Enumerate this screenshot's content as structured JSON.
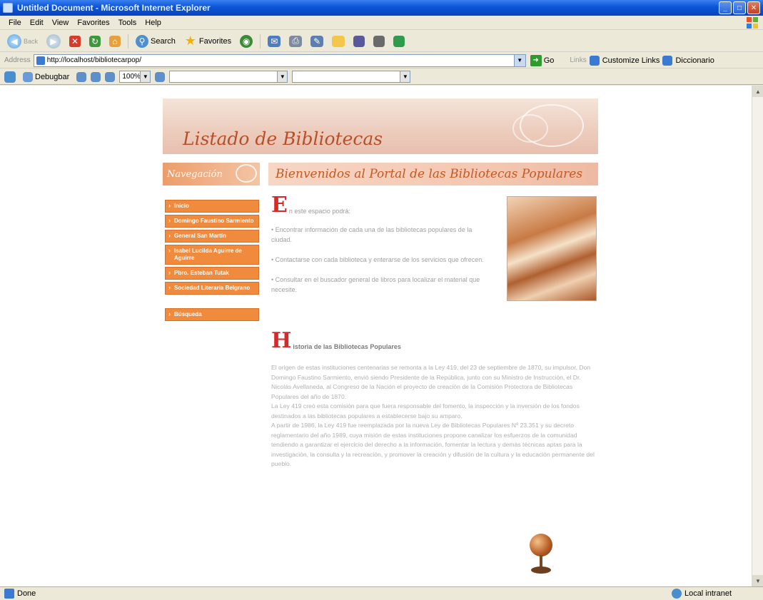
{
  "window": {
    "title": "Untitled Document - Microsoft Internet Explorer"
  },
  "menu": [
    "File",
    "Edit",
    "View",
    "Favorites",
    "Tools",
    "Help"
  ],
  "toolbar": {
    "back_label": "Back",
    "search_label": "Search",
    "favorites_label": "Favorites"
  },
  "address": {
    "label": "Address",
    "url": "http://localhost/bibliotecarpop/",
    "go_label": "Go",
    "links_label": "Links",
    "link1": "Customize Links",
    "link2": "Diccionario"
  },
  "debugbar": {
    "debug_label": "Debugbar",
    "zoom": "100%",
    "combo1": "",
    "combo2": ""
  },
  "page": {
    "banner_title": "Listado de Bibliotecas",
    "nav_header": "Navegación",
    "welcome": "Bienvenidos al Portal de las Bibliotecas Populares",
    "nav_items": [
      "Inicio",
      "Domingo Faustino Sarmiento",
      "General San Martín",
      "Isabel Lucilda Aguirre de Aguirre",
      "Pbro. Esteban Tutak",
      "Sociedad Literaria Belgrano"
    ],
    "nav_search": "Búsqueda",
    "intro_cap": "E",
    "intro_lead": "n este espacio podrá:",
    "bullets": [
      "• Encontrar información de cada una de las bibliotecas populares de la ciudad.",
      "• Contactarse con cada biblioteca y enterarse de los servicios que ofrecen.",
      "• Consultar en el buscador general de libros para localizar el material que necesite."
    ],
    "history_cap": "H",
    "history_title": "istoria de las Bibliotecas Populares",
    "history_paragraphs": [
      "El origen de estas instituciones centenarias se remonta a la Ley 419, del 23 de septiembre de 1870, su impulsor, Don Domingo Faustino Sarmiento, envió siendo Presidente de la República, junto con su Ministro de Instrucción, el Dr. Nicolás Avellaneda, al Congreso de la Nación el proyecto de creación de la Comisión Protectora de Bibliotecas Populares del año de 1870.",
      "La Ley 419 creó esta comisión para que fuera responsable del fomento, la inspección y la inversión de los fondos destinados a las bibliotecas populares a establecerse bajo su amparo.",
      "A partir de 1986, la Ley 419 fue reemplazada por la nueva Ley de Bibliotecas Populares Nº 23.351 y su decreto reglamentario del año 1989, cuya misión de estas instituciones propone canalizar los esfuerzos de la comunidad tendiendo a garantizar el ejercicio del derecho a la información, fomentar la lectura y demás técnicas aptas para la investigación, la consulta y la recreación, y promover la creación y difusión de la cultura y la educación permanente del pueblo."
    ]
  },
  "status": {
    "text": "Done",
    "zone": "Local intranet"
  }
}
